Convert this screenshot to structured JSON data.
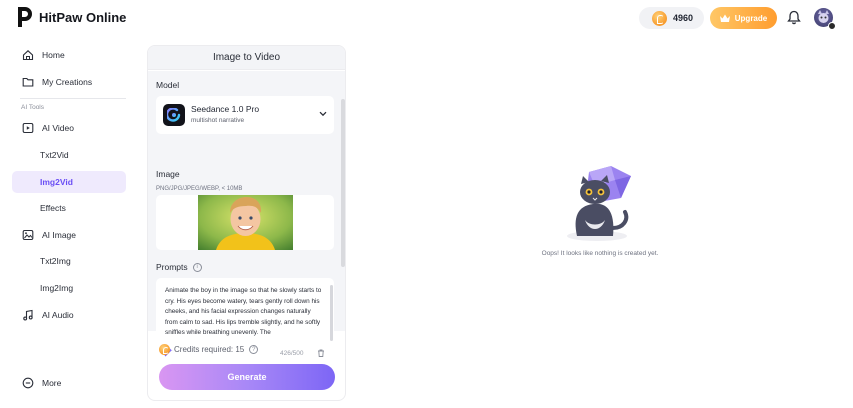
{
  "app": {
    "name": "HitPaw Online"
  },
  "header": {
    "credits": "4960",
    "upgrade_label": "Upgrade"
  },
  "sidebar": {
    "section_label": "AI Tools",
    "items": [
      {
        "label": "Home",
        "icon": "home-icon"
      },
      {
        "label": "My Creations",
        "icon": "folder-icon"
      },
      {
        "label": "AI Video",
        "icon": "video-icon"
      },
      {
        "label": "Txt2Vid"
      },
      {
        "label": "Img2Vid",
        "active": true
      },
      {
        "label": "Effects"
      },
      {
        "label": "AI Image",
        "icon": "image-icon"
      },
      {
        "label": "Txt2Img"
      },
      {
        "label": "Img2Img"
      },
      {
        "label": "AI Audio",
        "icon": "music-icon"
      }
    ],
    "more_label": "More"
  },
  "panel": {
    "title": "Image to Video",
    "model_label": "Model",
    "model": {
      "name": "Seedance 1.0 Pro",
      "sub": "multishot narrative"
    },
    "image_label": "Image",
    "image_formats": "PNG/JPG/JPEG/WEBP, < 10MB",
    "prompts_label": "Prompts",
    "prompt_text": "Animate the boy in the image so that he slowly starts to cry. His eyes become watery, tears gently roll down his cheeks, and his facial expression changes naturally from calm to sad. His lips tremble slightly, and he softly sniffles while breathing unevenly. The",
    "prompt_counter": "426/500",
    "credits_required": "Credits required: 15",
    "generate_label": "Generate"
  },
  "empty_state": {
    "message": "Oops! It looks like nothing is created yet."
  },
  "colors": {
    "accent": "#6a4ef5",
    "upgrade": "#ff9d2f",
    "generate_start": "#d996f2",
    "generate_end": "#7d66f5"
  }
}
